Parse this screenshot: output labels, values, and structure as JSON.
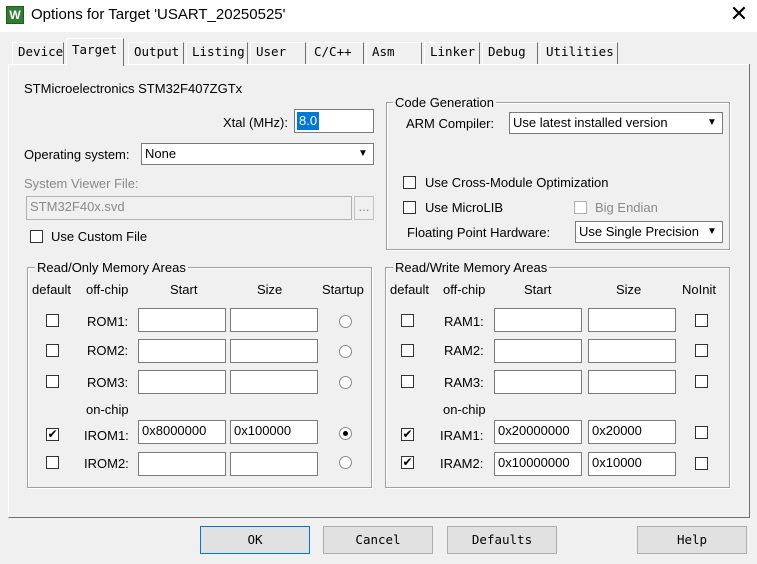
{
  "window": {
    "title": "Options for Target 'USART_20250525'",
    "app_icon_text": "W",
    "close_glyph": "✕"
  },
  "tabs": [
    {
      "label": "Device",
      "active": false
    },
    {
      "label": "Target",
      "active": true
    },
    {
      "label": "Output",
      "active": false
    },
    {
      "label": "Listing",
      "active": false
    },
    {
      "label": "User",
      "active": false
    },
    {
      "label": "C/C++",
      "active": false
    },
    {
      "label": "Asm",
      "active": false
    },
    {
      "label": "Linker",
      "active": false
    },
    {
      "label": "Debug",
      "active": false
    },
    {
      "label": "Utilities",
      "active": false
    }
  ],
  "target": {
    "device_name": "STMicroelectronics STM32F407ZGTx",
    "xtal_label": "Xtal (MHz):",
    "xtal_value": "8.0",
    "os_label": "Operating system:",
    "os_value": "None",
    "svd_label": "System Viewer File:",
    "svd_value": "STM32F40x.svd",
    "svd_browse": "...",
    "custom_file_label": "Use Custom File",
    "custom_file_checked": false
  },
  "code_generation": {
    "title": "Code Generation",
    "compiler_label": "ARM Compiler:",
    "compiler_value": "Use latest installed version",
    "cross_module_label": "Use Cross-Module Optimization",
    "cross_module_checked": false,
    "microlib_label": "Use MicroLIB",
    "microlib_checked": false,
    "big_endian_label": "Big Endian",
    "big_endian_checked": false,
    "fpu_label": "Floating Point Hardware:",
    "fpu_value": "Use Single Precision"
  },
  "ro_memory": {
    "title": "Read/Only Memory Areas",
    "headers": {
      "default": "default",
      "offchip": "off-chip",
      "start": "Start",
      "size": "Size",
      "startup": "Startup"
    },
    "onchip_label": "on-chip",
    "rows": [
      {
        "name": "ROM1:",
        "default": false,
        "start": "",
        "size": "",
        "startup": false
      },
      {
        "name": "ROM2:",
        "default": false,
        "start": "",
        "size": "",
        "startup": false
      },
      {
        "name": "ROM3:",
        "default": false,
        "start": "",
        "size": "",
        "startup": false
      },
      {
        "name": "IROM1:",
        "default": true,
        "start": "0x8000000",
        "size": "0x100000",
        "startup": true
      },
      {
        "name": "IROM2:",
        "default": false,
        "start": "",
        "size": "",
        "startup": false
      }
    ]
  },
  "rw_memory": {
    "title": "Read/Write Memory Areas",
    "headers": {
      "default": "default",
      "offchip": "off-chip",
      "start": "Start",
      "size": "Size",
      "noinit": "NoInit"
    },
    "onchip_label": "on-chip",
    "rows": [
      {
        "name": "RAM1:",
        "default": false,
        "start": "",
        "size": "",
        "noinit": false
      },
      {
        "name": "RAM2:",
        "default": false,
        "start": "",
        "size": "",
        "noinit": false
      },
      {
        "name": "RAM3:",
        "default": false,
        "start": "",
        "size": "",
        "noinit": false
      },
      {
        "name": "IRAM1:",
        "default": true,
        "start": "0x20000000",
        "size": "0x20000",
        "noinit": false
      },
      {
        "name": "IRAM2:",
        "default": true,
        "start": "0x10000000",
        "size": "0x10000",
        "noinit": false
      }
    ]
  },
  "buttons": {
    "ok": "OK",
    "cancel": "Cancel",
    "defaults": "Defaults",
    "help": "Help"
  },
  "glyphs": {
    "check": "✔",
    "dropdown": "▼"
  }
}
